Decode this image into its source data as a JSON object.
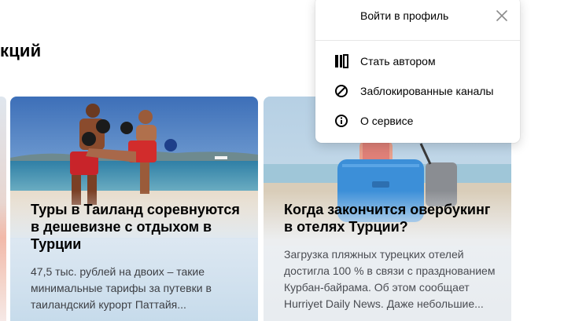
{
  "section": {
    "title": "кций"
  },
  "cards": [
    {
      "title": "Туры в Таиланд соревнуются в дешевизне с отдыхом в Турции",
      "snippet": "47,5 тыс. рублей на двоих – такие минимальные тарифы за путевки в таиландский курорт Паттайя..."
    },
    {
      "title": "Когда закончится овербукинг в отелях Турции?",
      "snippet": "Загрузка пляжных турецких отелей достигла 100 % в связи с празднованием Курбан-байрама. Об этом сообщает Hurriyet Daily News. Даже небольшие..."
    }
  ],
  "menu": {
    "login": "Войти в профиль",
    "items": [
      {
        "label": "Стать автором",
        "icon": "author-icon"
      },
      {
        "label": "Заблокированные каналы",
        "icon": "blocked-icon"
      },
      {
        "label": "О сервисе",
        "icon": "info-icon"
      }
    ]
  }
}
